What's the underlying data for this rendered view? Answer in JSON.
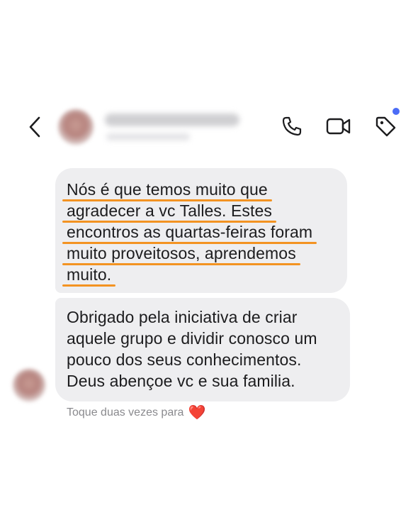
{
  "header": {
    "contact_name": "",
    "contact_subtitle": "",
    "notification_color": "#4b6cf6",
    "icons": [
      "chevron-left-icon",
      "phone-icon",
      "video-camera-icon",
      "tag-icon"
    ]
  },
  "messages": [
    {
      "lines": [
        "Nós é que temos muito que",
        "agradecer a vc Talles. Estes",
        "encontros as quartas-feiras foram",
        "muito proveitosos, aprendemos",
        "muito."
      ],
      "highlight_color": "#f39322"
    },
    {
      "lines": [
        "Obrigado pela iniciativa de criar",
        "aquele grupo e dividir conosco um",
        "pouco dos seus conhecimentos.",
        "Deus abençoe vc e sua familia."
      ]
    }
  ],
  "reaction_hint": {
    "text": "Toque duas vezes para",
    "emoji": "❤️"
  }
}
